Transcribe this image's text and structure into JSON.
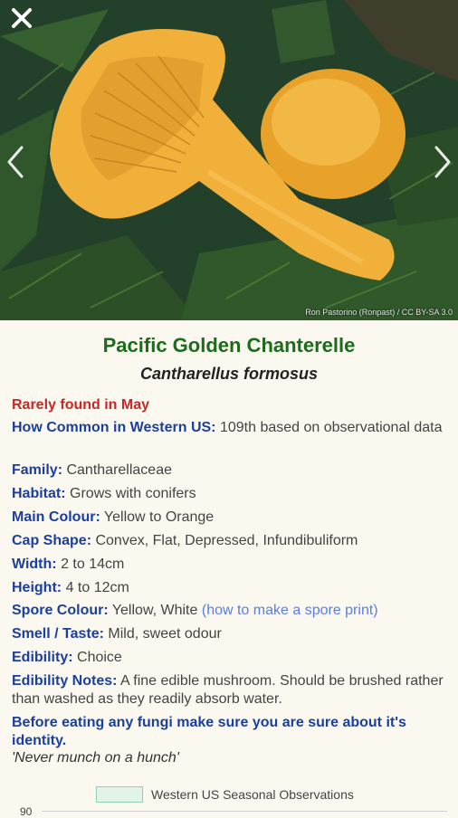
{
  "photo": {
    "credit": "Ron Pastorino (Ronpast) / CC BY-SA 3.0"
  },
  "icons": {
    "close": "close-icon",
    "prev": "chevron-left-icon",
    "next": "chevron-right-icon"
  },
  "species": {
    "common_name": "Pacific Golden Chanterelle",
    "latin_name": "Cantharellus formosus",
    "rarity": "Rarely found in May"
  },
  "details": {
    "how_common_label": "How Common in Western US:",
    "how_common_value": "109th based on observational data",
    "family_label": "Family:",
    "family_value": "Cantharellaceae",
    "habitat_label": "Habitat:",
    "habitat_value": "Grows with conifers",
    "main_colour_label": "Main Colour:",
    "main_colour_value": "Yellow to Orange",
    "cap_shape_label": "Cap Shape:",
    "cap_shape_value": "Convex, Flat, Depressed, Infundibuliform",
    "width_label": "Width:",
    "width_value": "2 to 14cm",
    "height_label": "Height:",
    "height_value": "4 to 12cm",
    "spore_colour_label": "Spore Colour:",
    "spore_colour_value": "Yellow, White",
    "spore_link": "(how to make a spore print)",
    "smell_label": "Smell / Taste:",
    "smell_value": "Mild, sweet odour",
    "edibility_label": "Edibility:",
    "edibility_value": "Choice",
    "edibility_notes_label": "Edibility Notes:",
    "edibility_notes_value": "A fine edible mushroom. Should be brushed rather than washed as they readily absorb water."
  },
  "warning": {
    "text": "Before eating any fungi make sure you are sure about it's identity.",
    "quote": "'Never munch on a hunch'"
  },
  "chart": {
    "legend": "Western US Seasonal Observations",
    "y_tick_top": "90"
  },
  "colors": {
    "title": "#1d6b1d",
    "label": "#1b3f9c",
    "rarity": "#c62828",
    "link": "#5b7fe3"
  }
}
